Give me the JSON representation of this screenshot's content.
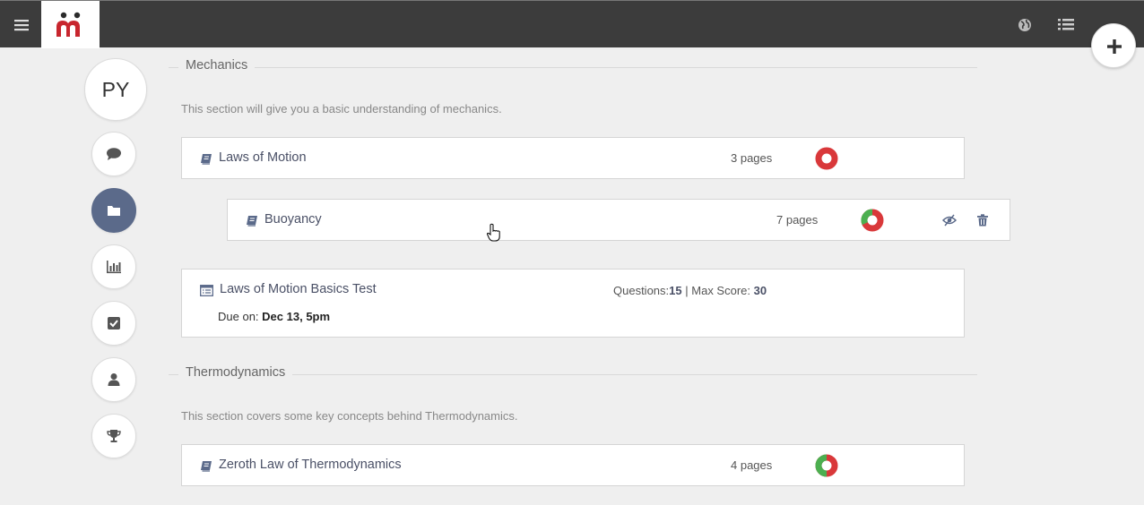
{
  "topbar": {
    "menu_icon": "hamburger-menu-icon",
    "logo_icon": "app-logo-icon",
    "globe_icon": "globe-icon",
    "list_icon": "list-view-icon",
    "add_icon": "plus-icon"
  },
  "sidebar": {
    "avatar_initials": "PY",
    "items": [
      {
        "icon": "comment-icon"
      },
      {
        "icon": "folder-icon",
        "active": true
      },
      {
        "icon": "bar-chart-icon"
      },
      {
        "icon": "checkbox-icon"
      },
      {
        "icon": "user-icon"
      },
      {
        "icon": "trophy-icon"
      }
    ]
  },
  "sections": [
    {
      "title": "Mechanics",
      "description": "This section will give you a basic understanding of mechanics.",
      "items": [
        {
          "type": "chapter",
          "name": "Laws of Motion",
          "pages": "3 pages",
          "progress": 0.0
        },
        {
          "type": "chapter",
          "name": "Buoyancy",
          "pages": "7 pages",
          "progress": 0.35,
          "nested": true
        },
        {
          "type": "test",
          "name": "Laws of Motion Basics Test",
          "questions_label": "Questions:",
          "questions": "15",
          "separator": "|",
          "max_score_label": "Max Score:",
          "max_score": "30",
          "due_label": "Due on:",
          "due": "Dec 13, 5pm"
        }
      ]
    },
    {
      "title": "Thermodynamics",
      "description": "This section covers some key concepts behind Thermodynamics.",
      "items": [
        {
          "type": "chapter",
          "name": "Zeroth Law of Thermodynamics",
          "pages": "4 pages",
          "progress": 0.5
        }
      ]
    }
  ],
  "colors": {
    "topbar": "#3c3c3c",
    "accent_red": "#d9383a",
    "accent_green": "#4caf50",
    "active_nav": "#5b6a8a"
  }
}
